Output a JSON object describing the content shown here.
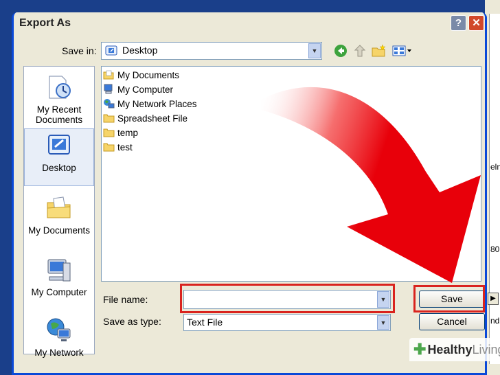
{
  "window": {
    "title": "Export As",
    "help_glyph": "?",
    "close_glyph": "✕"
  },
  "save_in": {
    "label": "Save in:",
    "value": "Desktop"
  },
  "toolbar": {
    "icons": [
      "back-icon",
      "up-folder-icon",
      "new-folder-icon",
      "views-menu-icon"
    ]
  },
  "places": [
    {
      "label": "My Recent Documents",
      "icon": "recent-documents-icon"
    },
    {
      "label": "Desktop",
      "icon": "desktop-icon",
      "selected": true
    },
    {
      "label": "My Documents",
      "icon": "my-documents-icon"
    },
    {
      "label": "My Computer",
      "icon": "my-computer-icon"
    },
    {
      "label": "My Network",
      "icon": "my-network-icon"
    }
  ],
  "files": [
    {
      "name": "My Documents",
      "icon": "documents-folder-icon"
    },
    {
      "name": "My Computer",
      "icon": "computer-icon"
    },
    {
      "name": "My Network Places",
      "icon": "network-places-icon"
    },
    {
      "name": "Spreadsheet File",
      "icon": "folder-icon"
    },
    {
      "name": "temp",
      "icon": "folder-icon"
    },
    {
      "name": "test",
      "icon": "folder-icon"
    }
  ],
  "file_name": {
    "label": "File name:",
    "value": ""
  },
  "save_as_type": {
    "label": "Save as type:",
    "value": "Text File"
  },
  "buttons": {
    "save": "Save",
    "cancel": "Cancel"
  },
  "background_fragments": {
    "a": "eln",
    "b": "80",
    "c": "nd",
    "arrow_glyph": "▶"
  },
  "watermark": {
    "brand": "Healthy",
    "brand2": "Living"
  },
  "colors": {
    "highlight": "#d9231e",
    "arrow": "#e8000a",
    "titlebar_border": "#0a49d8"
  }
}
